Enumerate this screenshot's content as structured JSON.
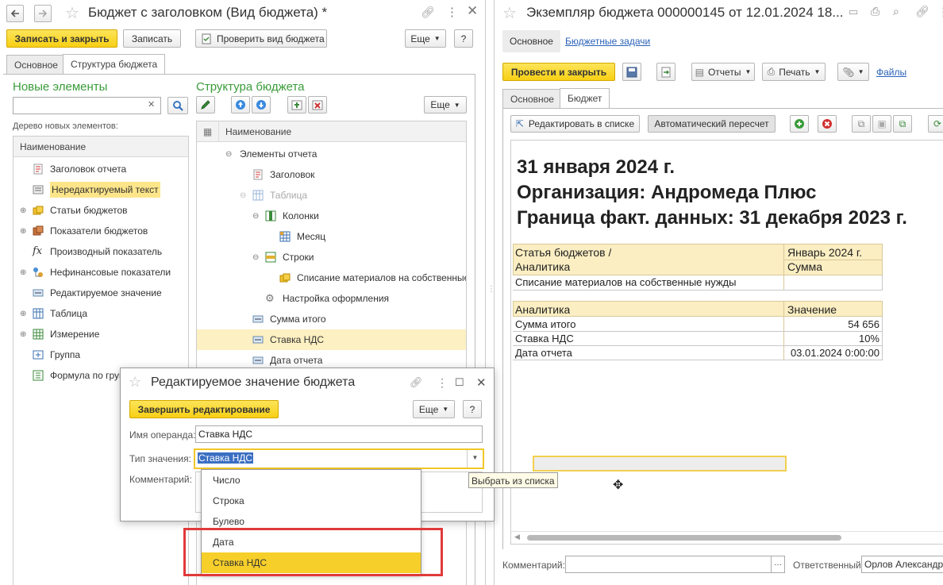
{
  "left_window": {
    "title": "Бюджет с заголовком (Вид бюджета) *",
    "toolbar": {
      "save_close": "Записать и закрыть",
      "save": "Записать",
      "check": "Проверить вид бюджета",
      "more": "Еще",
      "help": "?"
    },
    "tabs": [
      "Основное",
      "Структура бюджета"
    ],
    "new_elements": {
      "heading": "Новые элементы",
      "tree_label": "Дерево новых элементов:",
      "column": "Наименование",
      "items": [
        "Заголовок отчета",
        "Нередактируемый текст",
        "Статьи бюджетов",
        "Показатели бюджетов",
        "Производный показатель",
        "Нефинансовые показатели",
        "Редактируемое значение",
        "Таблица",
        "Измерение",
        "Группа",
        "Формула по груп"
      ]
    },
    "structure": {
      "heading": "Структура бюджета",
      "more": "Еще",
      "column": "Наименование",
      "items": [
        "Элементы отчета",
        "Заголовок",
        "Таблица",
        "Колонки",
        "Месяц",
        "Строки",
        "Списание материалов на собственные нужды",
        "Настройка оформления",
        "Сумма итого",
        "Ставка НДС",
        "Дата отчета"
      ]
    }
  },
  "dialog": {
    "title": "Редактируемое значение бюджета",
    "finish": "Завершить редактирование",
    "more": "Еще",
    "help": "?",
    "operand_label": "Имя операнда:",
    "operand_value": "Ставка НДС",
    "type_label": "Тип значения:",
    "type_value": "Ставка НДС",
    "comment_label": "Комментарий:",
    "dropdown_options": [
      "Число",
      "Строка",
      "Булево",
      "Дата",
      "Ставка НДС"
    ],
    "tooltip": "Выбрать из списка"
  },
  "right_window": {
    "title": "Экземпляр бюджета 000000145 от 12.01.2024 18...",
    "nav": [
      "Основное",
      "Бюджетные задачи"
    ],
    "toolbar": {
      "post_close": "Провести и закрыть",
      "reports": "Отчеты",
      "print": "Печать",
      "files": "Файлы"
    },
    "tabs": [
      "Основное",
      "Бюджет"
    ],
    "sub_toolbar": {
      "edit_list": "Редактировать в списке",
      "auto_recalc": "Автоматический пересчет"
    },
    "report": {
      "line1": "31 января 2024 г.",
      "line2": "Организация: Андромеда Плюс",
      "line3": "Граница факт. данных: 31 декабря 2023 г.",
      "table1": {
        "h1a": "Статья бюджетов /",
        "h1b": "Аналитика",
        "h2a": "Январь 2024 г.",
        "h2b": "Сумма",
        "row": "Списание материалов на собственные нужды"
      },
      "table2": {
        "h1": "Аналитика",
        "h2": "Значение",
        "rows": [
          [
            "Сумма итого",
            "54 656"
          ],
          [
            "Ставка НДС",
            "10%"
          ],
          [
            "Дата отчета",
            "03.01.2024 0:00:00"
          ]
        ]
      }
    },
    "footer": {
      "comment_label": "Комментарий:",
      "responsible_label": "Ответственный:",
      "responsible_value": "Орлов Александр"
    }
  }
}
